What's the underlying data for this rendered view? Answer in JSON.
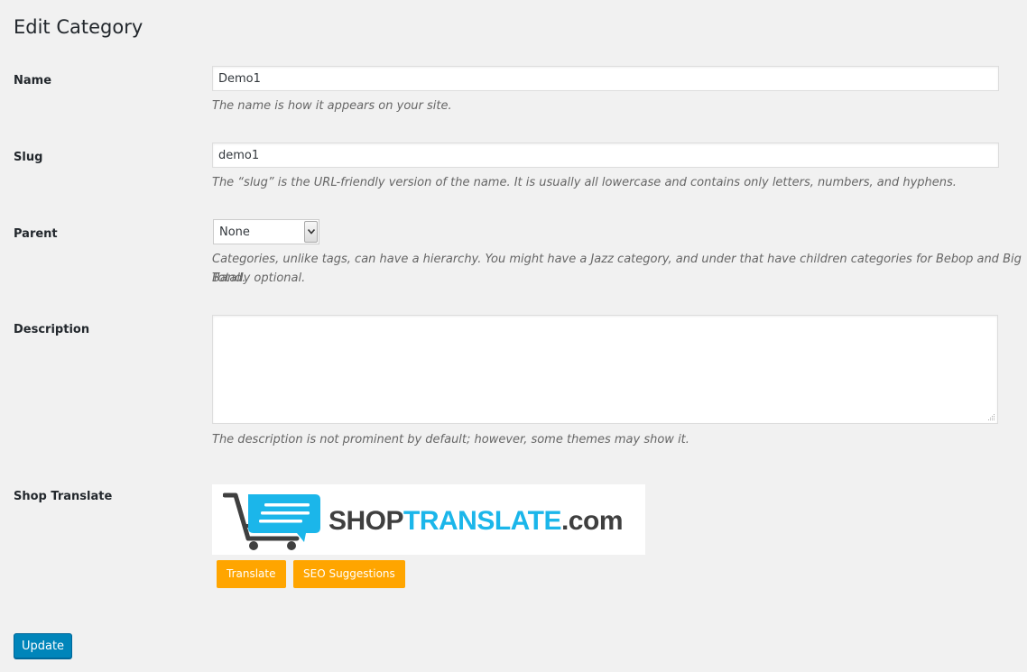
{
  "page": {
    "title": "Edit Category"
  },
  "form": {
    "name": {
      "label": "Name",
      "value": "Demo1",
      "description": "The name is how it appears on your site."
    },
    "slug": {
      "label": "Slug",
      "value": "demo1",
      "description": "The “slug” is the URL-friendly version of the name. It is usually all lowercase and contains only letters, numbers, and hyphens."
    },
    "parent": {
      "label": "Parent",
      "selected": "None",
      "description_line1": "Categories, unlike tags, can have a hierarchy. You might have a Jazz category, and under that have children categories for Bebop and Big Band.",
      "description_line2": "Totally optional."
    },
    "description": {
      "label": "Description",
      "value": "",
      "help": "The description is not prominent by default; however, some themes may show it."
    },
    "shop_translate": {
      "label": "Shop Translate",
      "logo_shop": "SHOP",
      "logo_translate": "TRANSLATE",
      "logo_com": ".com",
      "logo_colors": {
        "dark": "#3f3f3f",
        "blue": "#1bb6ea"
      },
      "translate_button": "Translate",
      "seo_button": "SEO Suggestions",
      "button_color": "#ffa500"
    }
  },
  "actions": {
    "update_label": "Update",
    "update_color": "#0085ba"
  }
}
